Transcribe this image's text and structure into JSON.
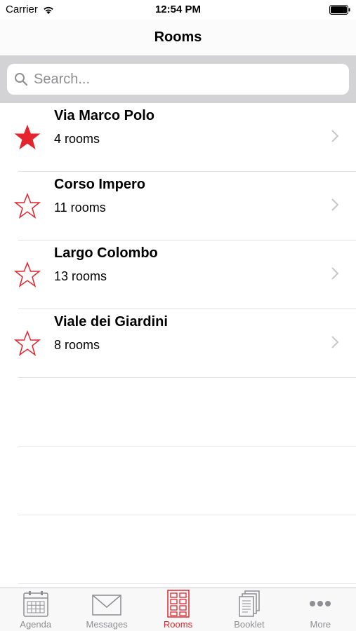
{
  "status_bar": {
    "carrier": "Carrier",
    "time": "12:54 PM"
  },
  "nav": {
    "title": "Rooms"
  },
  "search": {
    "placeholder": "Search..."
  },
  "rooms": [
    {
      "name": "Via Marco Polo",
      "count": "4 rooms",
      "favorite": true
    },
    {
      "name": "Corso Impero",
      "count": "11 rooms",
      "favorite": false
    },
    {
      "name": "Largo Colombo",
      "count": "13 rooms",
      "favorite": false
    },
    {
      "name": "Viale dei Giardini",
      "count": "8 rooms",
      "favorite": false
    }
  ],
  "tabs": [
    {
      "label": "Agenda",
      "icon": "calendar-icon",
      "active": false
    },
    {
      "label": "Messages",
      "icon": "envelope-icon",
      "active": false
    },
    {
      "label": "Rooms",
      "icon": "building-icon",
      "active": true
    },
    {
      "label": "Booklet",
      "icon": "booklet-icon",
      "active": false
    },
    {
      "label": "More",
      "icon": "more-dots-icon",
      "active": false
    }
  ],
  "colors": {
    "accent": "#e4252d",
    "inactive": "#8e8e93"
  }
}
